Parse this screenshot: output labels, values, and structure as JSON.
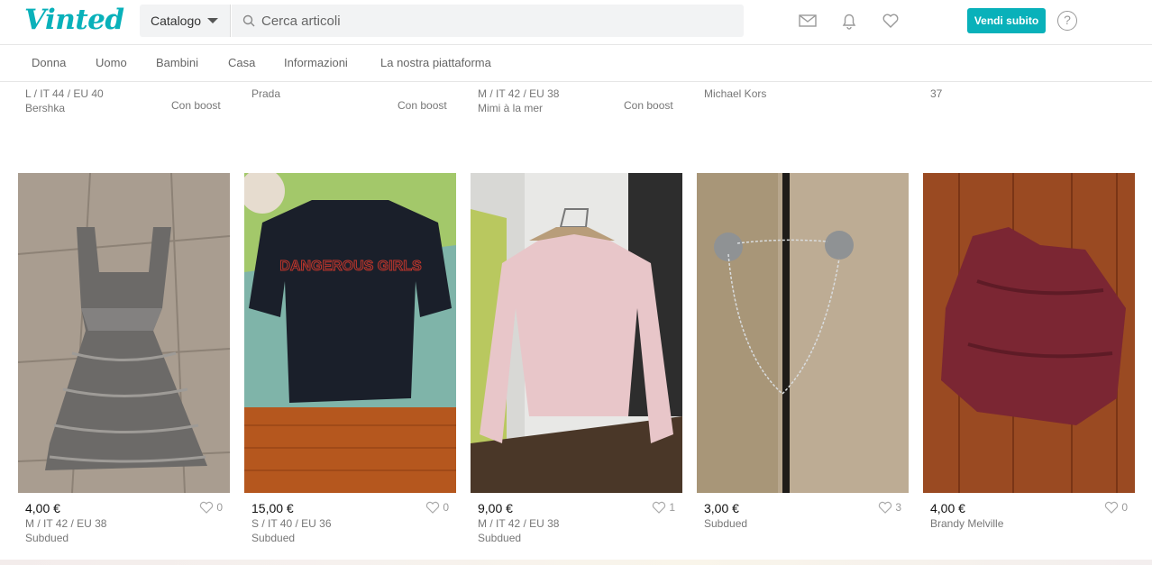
{
  "header": {
    "logo": "Vinted",
    "catalog_label": "Catalogo",
    "search_placeholder": "Cerca articoli",
    "sell_label": "Vendi subito",
    "help_label": "?"
  },
  "nav": [
    "Donna",
    "Uomo",
    "Bambini",
    "Casa",
    "Informazioni",
    "La nostra piattaforma"
  ],
  "top_row": [
    {
      "line1": "L / IT 44 / EU 40",
      "line2": "Bershka",
      "boost": "Con boost"
    },
    {
      "line1": "Prada",
      "line2": "",
      "boost": "Con boost"
    },
    {
      "line1": "M / IT 42 / EU 38",
      "line2": "Mimi à la mer",
      "boost": "Con boost"
    },
    {
      "line1": "Michael Kors",
      "line2": "",
      "boost": ""
    },
    {
      "line1": "37",
      "line2": "",
      "boost": ""
    }
  ],
  "items": [
    {
      "price": "4,00 €",
      "likes": "0",
      "size": "M / IT 42 / EU 38",
      "brand": "Subdued"
    },
    {
      "price": "15,00 €",
      "likes": "0",
      "size": "S / IT 40 / EU 36",
      "brand": "Subdued",
      "print": "DANGEROUS GIRLS"
    },
    {
      "price": "9,00 €",
      "likes": "1",
      "size": "M / IT 42 / EU 38",
      "brand": "Subdued"
    },
    {
      "price": "3,00 €",
      "likes": "3",
      "size": "Subdued",
      "brand": ""
    },
    {
      "price": "4,00 €",
      "likes": "0",
      "size": "Brandy Melville",
      "brand": ""
    }
  ],
  "colors": {
    "accent": "#09b1ba"
  }
}
